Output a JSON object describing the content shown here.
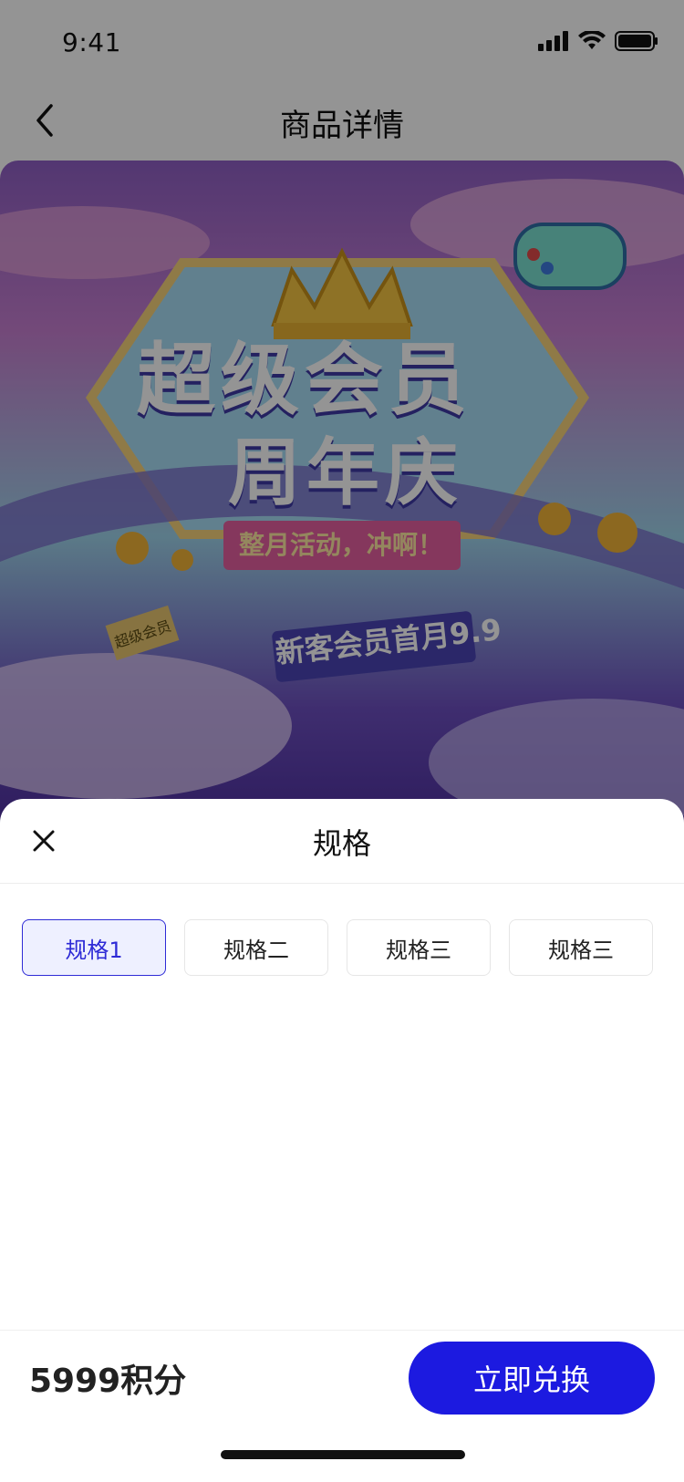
{
  "status": {
    "time": "9:41"
  },
  "nav": {
    "title": "商品详情"
  },
  "banner": {
    "headline": "超级会员",
    "subheadline": "周年庆",
    "ribbon": "整月活动，冲啊！",
    "promo": "新客会员首月9.9",
    "mini_brand": "超级会员"
  },
  "sheet": {
    "title": "规格",
    "specs": [
      "规格1",
      "规格二",
      "规格三",
      "规格三"
    ],
    "selected_index": 0
  },
  "footer": {
    "price": "5999积分",
    "button": "立即兑换"
  },
  "colors": {
    "accent": "#1c1ae0",
    "chip_active_bg": "#eef0ff"
  }
}
